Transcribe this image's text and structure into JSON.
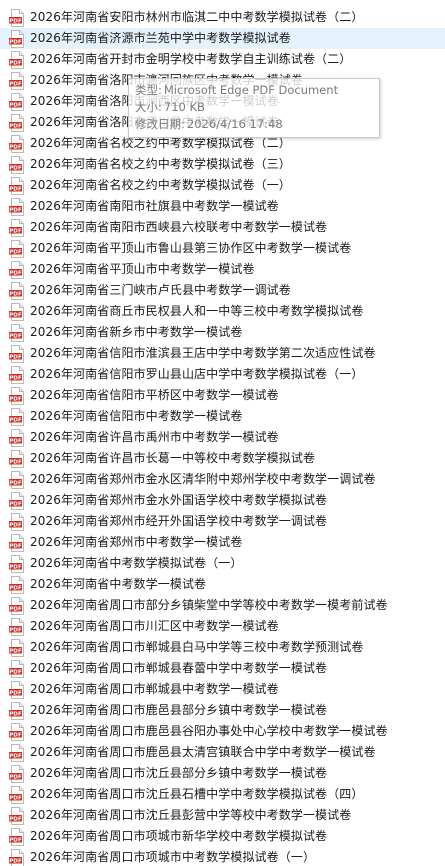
{
  "files": [
    {
      "name": "2026年河南省安阳市林州市临淇二中中考数学模拟试卷（二）",
      "selected": false
    },
    {
      "name": "2026年河南省济源市兰苑中学中考数学模拟试卷",
      "selected": true
    },
    {
      "name": "2026年河南省开封市金明学校中考数学自主训练试卷（二）",
      "selected": false
    },
    {
      "name": "2026年河南省洛阳市瀍河回族区中考数学一模试卷",
      "selected": false
    },
    {
      "name": "2026年河南省洛阳市涧西区中考数学一模试卷",
      "selected": false
    },
    {
      "name": "2026年河南省洛阳市伊川县中考数学一模试卷",
      "selected": false
    },
    {
      "name": "2026年河南省名校之约中考数学模拟试卷（二）",
      "selected": false
    },
    {
      "name": "2026年河南省名校之约中考数学模拟试卷（三）",
      "selected": false
    },
    {
      "name": "2026年河南省名校之约中考数学模拟试卷（一）",
      "selected": false
    },
    {
      "name": "2026年河南省南阳市社旗县中考数学一模试卷",
      "selected": false
    },
    {
      "name": "2026年河南省南阳市西峡县六校联考中考数学一模试卷",
      "selected": false
    },
    {
      "name": "2026年河南省平顶山市鲁山县第三协作区中考数学一模试卷",
      "selected": false
    },
    {
      "name": "2026年河南省平顶山市中考数学一模试卷",
      "selected": false
    },
    {
      "name": "2026年河南省三门峡市卢氏县中考数学一调试卷",
      "selected": false
    },
    {
      "name": "2026年河南省商丘市民权县人和一中等三校中考数学模拟试卷",
      "selected": false
    },
    {
      "name": "2026年河南省新乡市中考数学一模试卷",
      "selected": false
    },
    {
      "name": "2026年河南省信阳市淮滨县王店中学中考数学第二次适应性试卷",
      "selected": false
    },
    {
      "name": "2026年河南省信阳市罗山县山店中学中考数学模拟试卷（一）",
      "selected": false
    },
    {
      "name": "2026年河南省信阳市平桥区中考数学一模试卷",
      "selected": false
    },
    {
      "name": "2026年河南省信阳市中考数学一模试卷",
      "selected": false
    },
    {
      "name": "2026年河南省许昌市禹州市中考数学一模试卷",
      "selected": false
    },
    {
      "name": "2026年河南省许昌市长葛一中等校中考数学模拟试卷",
      "selected": false
    },
    {
      "name": "2026年河南省郑州市金水区清华附中郑州学校中考数学一调试卷",
      "selected": false
    },
    {
      "name": "2026年河南省郑州市金水外国语学校中考数学模拟试卷",
      "selected": false
    },
    {
      "name": "2026年河南省郑州市经开外国语学校中考数学一调试卷",
      "selected": false
    },
    {
      "name": "2026年河南省郑州市中考数学一模试卷",
      "selected": false
    },
    {
      "name": "2026年河南省中考数学模拟试卷（一）",
      "selected": false
    },
    {
      "name": "2026年河南省中考数学一模试卷",
      "selected": false
    },
    {
      "name": "2026年河南省周口市部分乡镇柴堂中学等校中考数学一模考前试卷",
      "selected": false
    },
    {
      "name": "2026年河南省周口市川汇区中考数学一模试卷",
      "selected": false
    },
    {
      "name": "2026年河南省周口市郸城县白马中学等三校中考数学预测试卷",
      "selected": false
    },
    {
      "name": "2026年河南省周口市郸城县春蕾中学中考数学一模试卷",
      "selected": false
    },
    {
      "name": "2026年河南省周口市郸城县中考数学一模试卷",
      "selected": false
    },
    {
      "name": "2026年河南省周口市鹿邑县部分乡镇中考数学一模试卷",
      "selected": false
    },
    {
      "name": "2026年河南省周口市鹿邑县谷阳办事处中心学校中考数学一模试卷",
      "selected": false
    },
    {
      "name": "2026年河南省周口市鹿邑县太清宫镇联合中学中考数学一模试卷",
      "selected": false
    },
    {
      "name": "2026年河南省周口市沈丘县部分乡镇中考数学一模试卷",
      "selected": false
    },
    {
      "name": "2026年河南省周口市沈丘县石槽中学中考数学模拟试卷（四）",
      "selected": false
    },
    {
      "name": "2026年河南省周口市沈丘县彭营中学等校中考数学一模试卷",
      "selected": false
    },
    {
      "name": "2026年河南省周口市项城市新华学校中考数学模拟试卷",
      "selected": false
    },
    {
      "name": "2026年河南省周口市项城市中考数学模拟试卷（一）",
      "selected": false
    }
  ],
  "icon": {
    "name": "pdf-icon",
    "label": "PDF",
    "color": "#d62a22"
  },
  "tooltip": {
    "type_label": "类型:",
    "type_value": "Microsoft Edge PDF Document",
    "size_label": "大小:",
    "size_value": "710 KB",
    "date_label": "修改日期:",
    "date_value": "2026/4/16 17:48"
  }
}
